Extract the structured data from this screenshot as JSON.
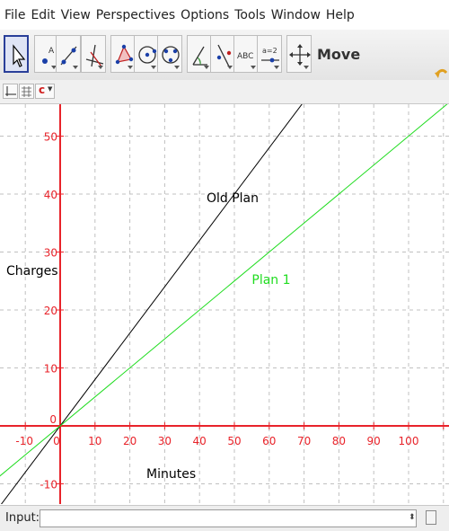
{
  "menu": [
    "File",
    "Edit",
    "View",
    "Perspectives",
    "Options",
    "Tools",
    "Window",
    "Help"
  ],
  "toolbar": {
    "active_tool_label": "Move",
    "tools": [
      "move-tool",
      "point-tool",
      "line-tool",
      "perpendicular-line-tool",
      "polygon-tool",
      "circle-tool",
      "conic-tool",
      "angle-tool",
      "reflect-tool",
      "text-tool",
      "slider-tool",
      "move-view-tool"
    ],
    "text_tool_glyph": "ABC",
    "slider_tool_glyph": "a=2"
  },
  "stylebar": {
    "color_button_glyph": "c"
  },
  "graph": {
    "x_ticks": [
      "-10",
      "0",
      "10",
      "20",
      "30",
      "40",
      "50",
      "60",
      "70",
      "80",
      "90",
      "100"
    ],
    "y_ticks": [
      "50",
      "40",
      "30",
      "20",
      "10",
      "0",
      "-10"
    ],
    "x_axis_label": "Minutes",
    "y_axis_label": "Charges",
    "colors": {
      "axis": "#e8232a",
      "grid": "#c0c0c0",
      "old_plan": "#000000",
      "plan1": "#1fdc1f"
    }
  },
  "chart_data": {
    "type": "line",
    "xlabel": "Minutes",
    "ylabel": "Charges",
    "xlim": [
      -17,
      110
    ],
    "ylim": [
      -14,
      55
    ],
    "grid": true,
    "series": [
      {
        "name": "Old Plan",
        "slope": 0.8,
        "intercept": 0
      },
      {
        "name": "Plan 1",
        "slope": 0.5,
        "intercept": 0
      }
    ]
  },
  "input_bar": {
    "label": "Input:",
    "value": ""
  }
}
